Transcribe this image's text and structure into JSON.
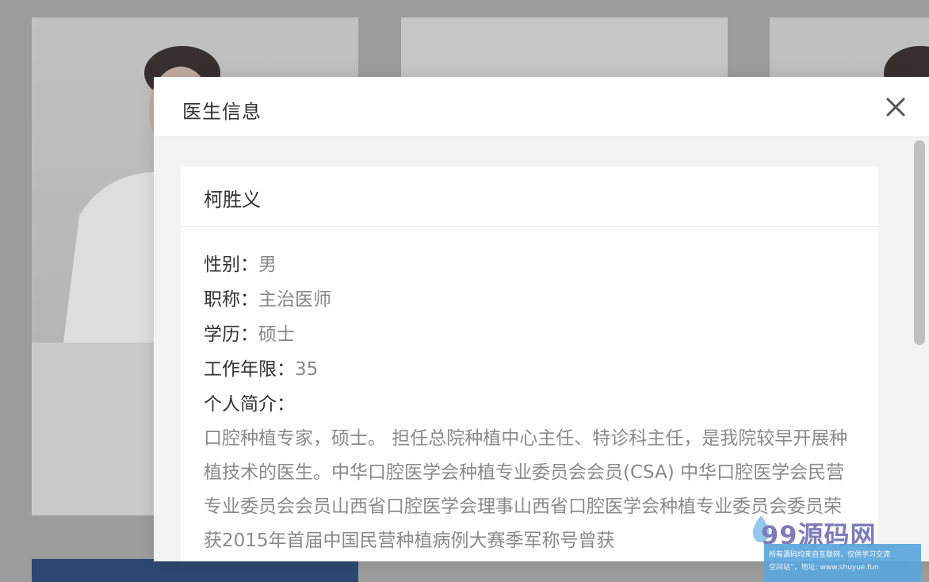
{
  "dialog": {
    "title": "医生信息",
    "close_icon": "close-icon"
  },
  "doctor": {
    "name": "柯胜义",
    "fields": [
      {
        "label": "性别：",
        "value": "男"
      },
      {
        "label": "职称：",
        "value": "主治医师"
      },
      {
        "label": "学历：",
        "value": "硕士"
      },
      {
        "label": "工作年限：",
        "value": "35"
      }
    ],
    "intro_label": "个人简介：",
    "intro_text": "口腔种植专家，硕士。 担任总院种植中心主任、特诊科主任，是我院较早开展种植技术的医生。中华口腔医学会种植专业委员会会员(CSA) 中华口腔医学会民营专业委员会会员山西省口腔医学会理事山西省口腔医学会种植专业委员会委员荣获2015年首届中国民营种植病例大赛季军称号曾获"
  },
  "watermark": {
    "brand": "99源码网",
    "line1": "所有源码均来自互联网，仅供学习交流",
    "line2": "空间站”，地址: www.shuyue.fun"
  },
  "colors": {
    "overlay": "#a3a3a3",
    "dialog_header": "#ffffff",
    "body_bg": "#f3f3f3",
    "value_text": "#888888",
    "watermark_bar": "#5aa6dc"
  }
}
